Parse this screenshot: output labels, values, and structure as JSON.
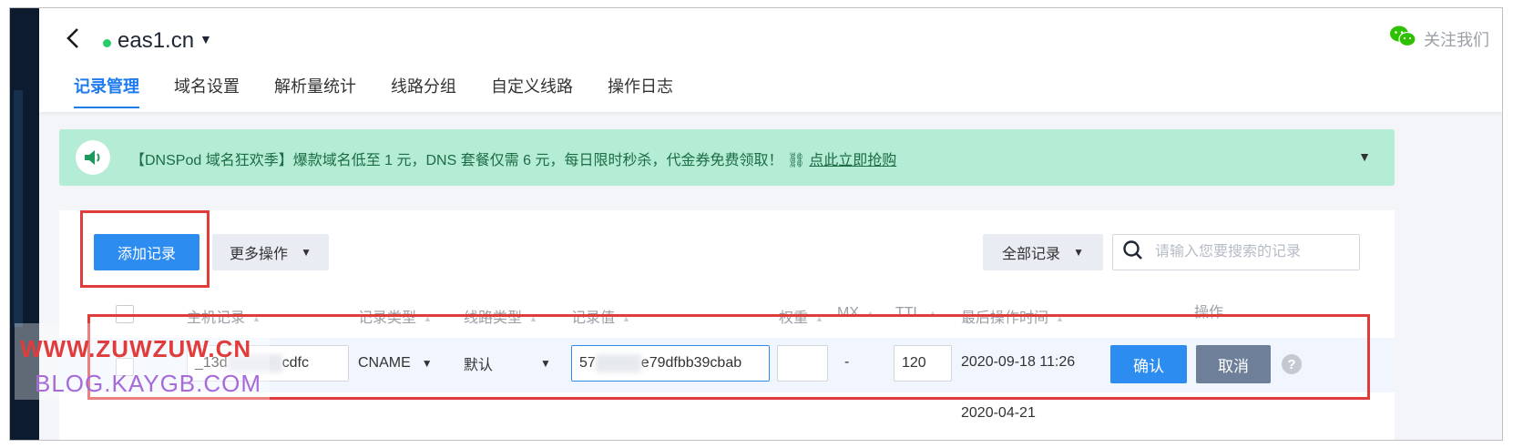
{
  "header": {
    "domain": "eas1.cn",
    "follow_label": "关注我们"
  },
  "tabs": [
    {
      "label": "记录管理",
      "active": true
    },
    {
      "label": "域名设置",
      "active": false
    },
    {
      "label": "解析量统计",
      "active": false
    },
    {
      "label": "线路分组",
      "active": false
    },
    {
      "label": "自定义线路",
      "active": false
    },
    {
      "label": "操作日志",
      "active": false
    }
  ],
  "banner": {
    "text": "【DNSPod 域名狂欢季】爆款域名低至 1 元，DNS 套餐仅需 6 元，每日限时秒杀，代金券免费领取！",
    "link": "点此立即抢购"
  },
  "toolbar": {
    "add_label": "添加记录",
    "more_label": "更多操作",
    "filter_label": "全部记录",
    "search_placeholder": "请输入您要搜索的记录"
  },
  "table": {
    "columns": [
      "主机记录",
      "记录类型",
      "线路类型",
      "记录值",
      "权重",
      "MX",
      "TTL",
      "最后操作时间",
      "操作"
    ],
    "edit_row": {
      "host_prefix": "_13d",
      "host_suffix": "cdfc",
      "type": "CNAME",
      "line": "默认",
      "value_prefix": "57",
      "value_suffix": "e79dfbb39cbab",
      "weight": "",
      "mx": "-",
      "ttl": "120",
      "time": "2020-09-18 11:26",
      "confirm_label": "确认",
      "cancel_label": "取消",
      "help": "?"
    },
    "next_row_time": "2020-04-21"
  },
  "watermark": {
    "line1": "WWW.ZUWZUW.CN",
    "line2": "BLOG.KAYGB.COM"
  },
  "colors": {
    "primary": "#2d8cf0",
    "banner_bg": "#b4ecd6",
    "annotation_red": "#e03c3c"
  }
}
